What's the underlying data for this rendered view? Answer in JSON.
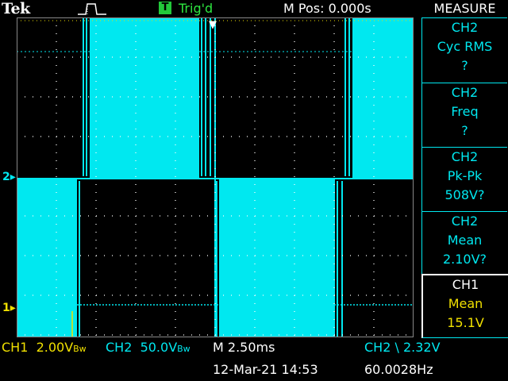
{
  "header": {
    "brand": "Tek",
    "trigger_icon": "pulse-icon",
    "trigger_badge": "T",
    "trigger_state": "Trig'd",
    "horizontal_position": "M Pos: 0.000s"
  },
  "measure_menu": {
    "title": "MEASURE",
    "items": [
      {
        "source": "CH2",
        "type": "Cyc RMS",
        "value": "?"
      },
      {
        "source": "CH2",
        "type": "Freq",
        "value": "?"
      },
      {
        "source": "CH2",
        "type": "Pk-Pk",
        "value": "508V?"
      },
      {
        "source": "CH2",
        "type": "Mean",
        "value": "2.10V?"
      },
      {
        "source": "CH1",
        "type": "Mean",
        "value": "15.1V"
      }
    ]
  },
  "markers": {
    "ch2": "2",
    "ch1": "1",
    "trigger_position": "▼",
    "trigger_level": "◂"
  },
  "status": {
    "ch1_label": "CH1",
    "ch1_scale": "2.00V",
    "ch1_bw": "Bw",
    "ch2_label": "CH2",
    "ch2_scale": "50.0V",
    "ch2_bw": "Bw",
    "timebase": "M 2.50ms",
    "trigger_source": "CH2",
    "trigger_slope": "\\",
    "trigger_level": "2.32V",
    "date_time": "12-Mar-21 14:53",
    "trigger_frequency": "60.0028Hz"
  },
  "colors": {
    "ch1": "#f0e000",
    "ch2": "#00e8f0",
    "trigger_ok": "#22c83a",
    "background": "#000000"
  }
}
